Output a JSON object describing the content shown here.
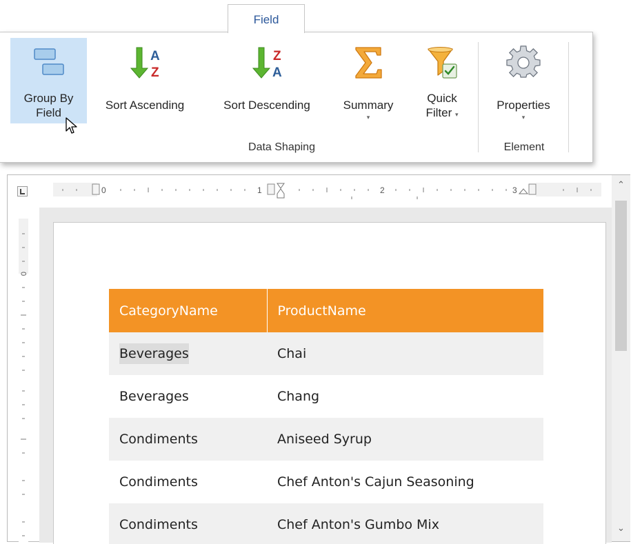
{
  "ribbon": {
    "active_tab": "Field",
    "buttons": {
      "group_by_field": {
        "line1": "Group By",
        "line2": "Field",
        "icon": "group-by-field-icon"
      },
      "sort_ascending": {
        "label": "Sort Ascending",
        "icon": "sort-ascending-icon"
      },
      "sort_descending": {
        "label": "Sort Descending",
        "icon": "sort-descending-icon"
      },
      "summary": {
        "label": "Summary",
        "icon": "sigma-icon",
        "dropdown": "▾"
      },
      "quick_filter": {
        "line1": "Quick",
        "line2": "Filter",
        "icon": "funnel-filter-icon",
        "dropdown": "▾"
      },
      "properties": {
        "label": "Properties",
        "icon": "gear-icon",
        "dropdown": "▾"
      }
    },
    "groups": {
      "data_shaping": "Data Shaping",
      "element": "Element"
    }
  },
  "ruler": {
    "marks": [
      "0",
      "1",
      "2",
      "3"
    ],
    "vertical_marks": [
      "0"
    ]
  },
  "table": {
    "headers": [
      "CategoryName",
      "ProductName"
    ],
    "rows": [
      {
        "category": "Beverages",
        "product": "Chai"
      },
      {
        "category": "Beverages",
        "product": "Chang"
      },
      {
        "category": "Condiments",
        "product": "Aniseed Syrup"
      },
      {
        "category": "Condiments",
        "product": "Chef Anton's Cajun Seasoning"
      },
      {
        "category": "Condiments",
        "product": "Chef Anton's Gumbo Mix"
      }
    ]
  },
  "colors": {
    "header_bg": "#f39325",
    "active_button_bg": "#cde3f7",
    "tab_text": "#2b579a"
  }
}
